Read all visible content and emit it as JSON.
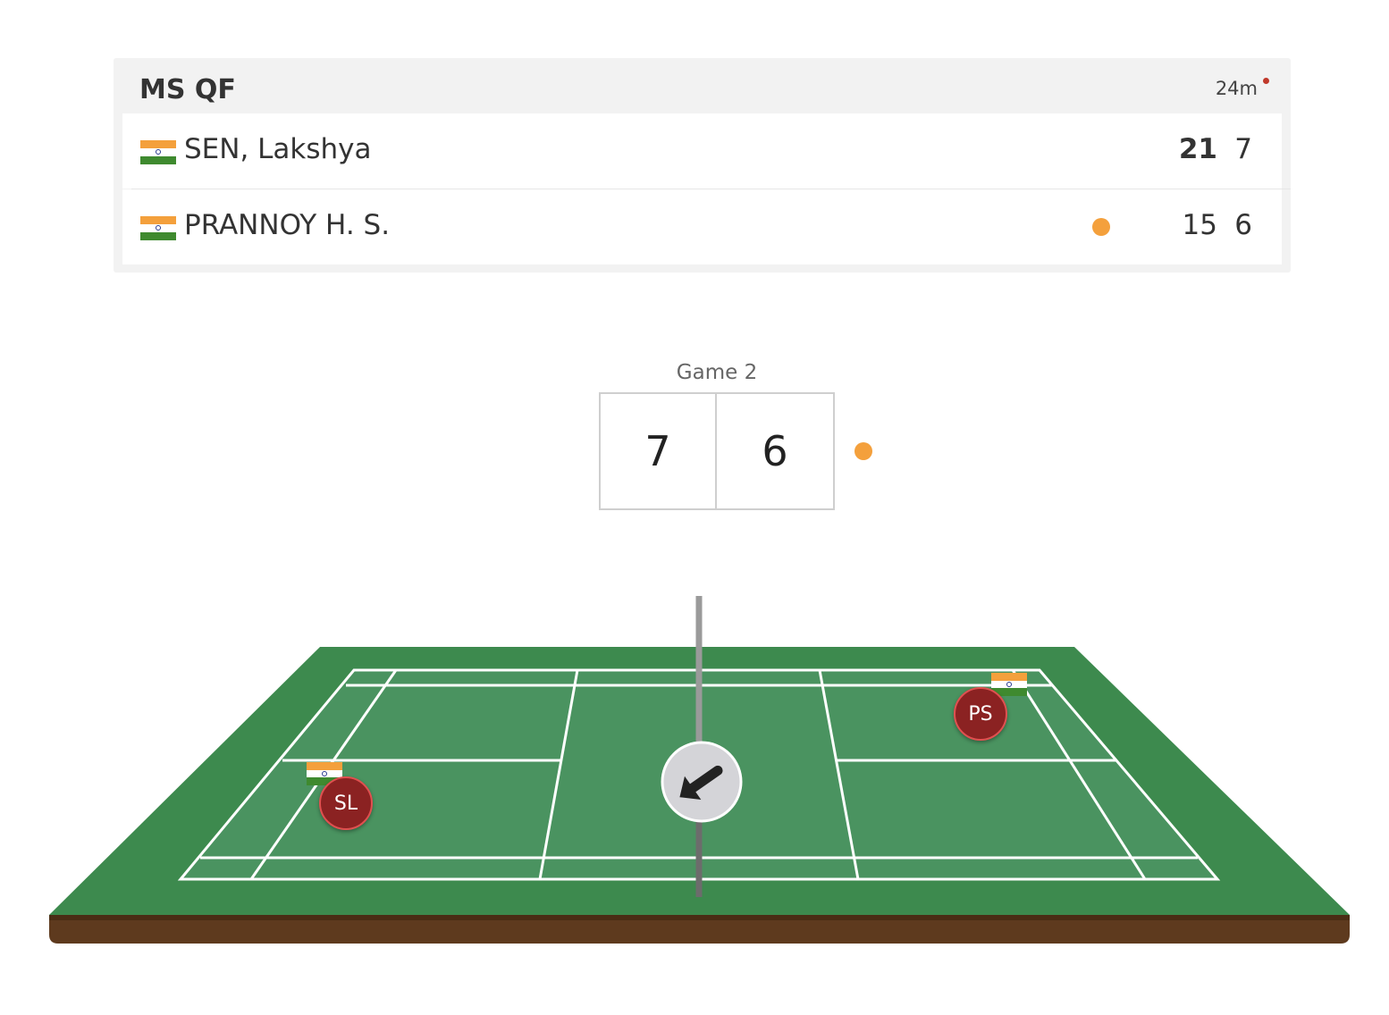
{
  "match": {
    "round": "MS QF",
    "duration": "24m"
  },
  "players": [
    {
      "name": "SEN, Lakshya",
      "country_flag": "india-flag-icon",
      "game1": "21",
      "game2": "7",
      "initials": "SL",
      "serving": false
    },
    {
      "name": "PRANNOY H. S.",
      "country_flag": "india-flag-icon",
      "game1": "15",
      "game2": "6",
      "initials": "PS",
      "serving": true
    }
  ],
  "current_game": {
    "label": "Game 2",
    "score_left": "7",
    "score_right": "6"
  },
  "colors": {
    "serve_indicator": "#f4a03c",
    "live_indicator": "#c0392b",
    "court_green": "#4a9360",
    "court_surround": "#3d8a4e",
    "court_base": "#5e3a1e",
    "player_badge": "#8b2222"
  },
  "icons": {
    "shuttle_direction": "arrow-down-left-icon"
  }
}
